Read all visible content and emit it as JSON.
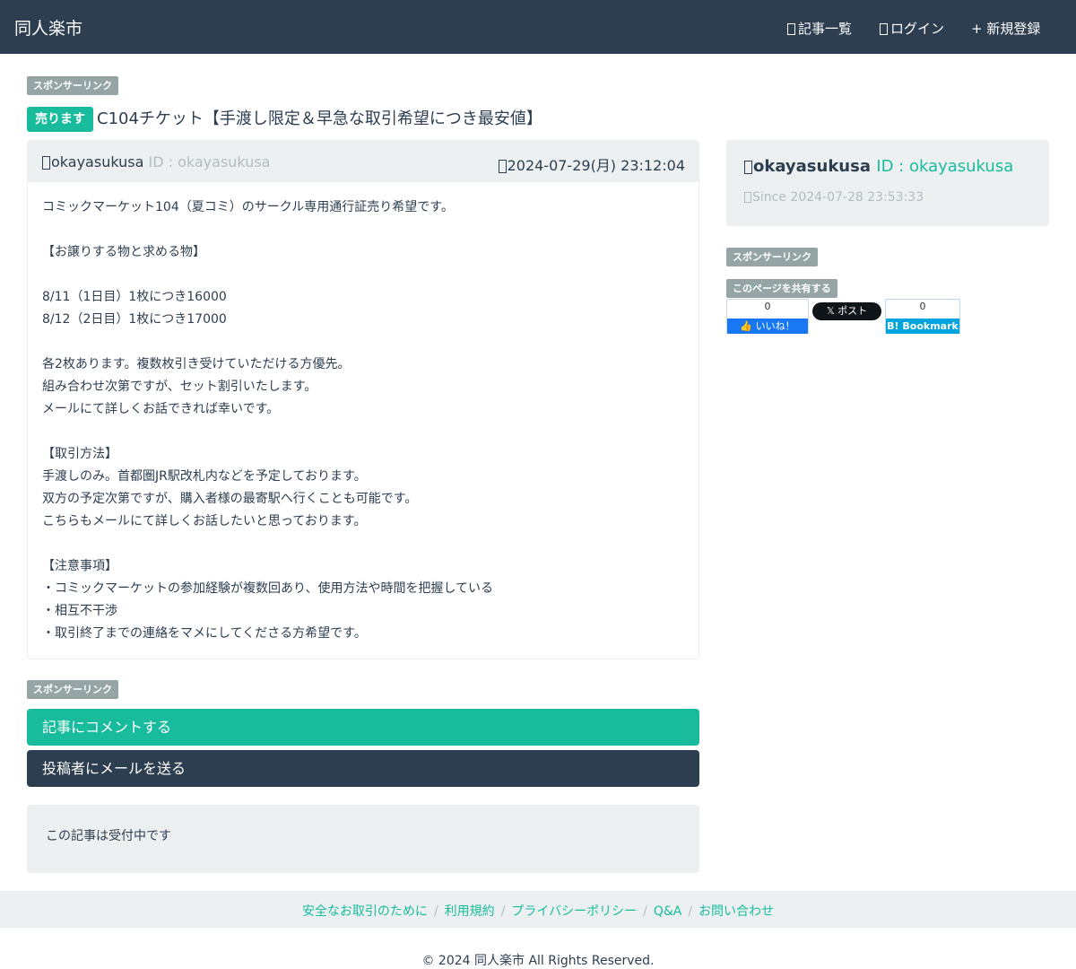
{
  "header": {
    "brand": "同人楽市",
    "nav": [
      {
        "label": "記事一覧"
      },
      {
        "label": "ログイン"
      },
      {
        "label": "+ 新規登録"
      }
    ]
  },
  "sponsor_label": "スポンサーリンク",
  "post": {
    "badge": "売ります",
    "title": "C104チケット【手渡し限定＆早急な取引希望につき最安値】",
    "author": "okayasukusa",
    "author_id": "ID : okayasukusa",
    "date": "2024-07-29(月) 23:12:04",
    "body_lines": [
      "コミックマーケット104（夏コミ）のサークル専用通行証売り希望です。",
      "",
      "【お譲りする物と求める物】",
      "",
      "8/11（1日目）1枚につき16000",
      "8/12（2日目）1枚につき17000",
      "",
      "各2枚あります。複数枚引き受けていただける方優先。",
      "組み合わせ次第ですが、セット割引いたします。",
      "メールにて詳しくお話できれば幸いです。",
      "",
      "【取引方法】",
      "手渡しのみ。首都圏JR駅改札内などを予定しております。",
      "双方の予定次第ですが、購入者様の最寄駅へ行くことも可能です。",
      "こちらもメールにて詳しくお話したいと思っております。",
      "",
      "【注意事項】",
      "・コミックマーケットの参加経験が複数回あり、使用方法や時間を把握している",
      "・相互不干渉",
      "・取引終了までの連絡をマメにしてくださる方希望です。"
    ]
  },
  "actions": {
    "comment": "記事にコメントする",
    "mail": "投稿者にメールを送る"
  },
  "status": "この記事は受付中です",
  "sidebar": {
    "profile_name": "okayasukusa",
    "profile_id": "ID : okayasukusa",
    "since": "Since 2024-07-28 23:53:33",
    "share_label": "このページを共有する",
    "fb_count": "0",
    "fb_like": "いいね！",
    "x_post": "ポスト",
    "hb_count": "0",
    "hb_bookmark": "Bookmark"
  },
  "footer": {
    "links": [
      "安全なお取引のために",
      "利用規約",
      "プライバシーポリシー",
      "Q&A",
      "お問い合わせ"
    ],
    "copyright": "© 2024 同人楽市 All Rights Reserved."
  },
  "colors": {
    "primary": "#2c3e50",
    "accent": "#18bc9c",
    "muted": "#95a5a6",
    "well": "#ecf0f1"
  }
}
